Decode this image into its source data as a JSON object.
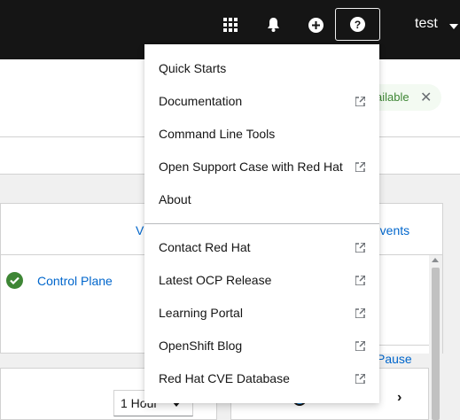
{
  "masthead": {
    "apps_icon": "grid-icon",
    "notifications_icon": "bell-icon",
    "add_icon": "plus-circle-icon",
    "help_icon": "question-circle-icon",
    "user_name": "test"
  },
  "background": {
    "badge_text": "ailable",
    "card_links": [
      "V",
      "v events"
    ],
    "status_label": "Control Plane",
    "pause_label": "Pause",
    "time_select": "1 Hour"
  },
  "help_menu": {
    "group1": [
      {
        "label": "Quick Starts",
        "external": false
      },
      {
        "label": "Documentation",
        "external": true
      },
      {
        "label": "Command Line Tools",
        "external": false
      },
      {
        "label": "Open Support Case with Red Hat",
        "external": true
      },
      {
        "label": "About",
        "external": false
      }
    ],
    "group2": [
      {
        "label": "Contact Red Hat",
        "external": true
      },
      {
        "label": "Latest OCP Release",
        "external": true
      },
      {
        "label": "Learning Portal",
        "external": true
      },
      {
        "label": "OpenShift Blog",
        "external": true
      },
      {
        "label": "Red Hat CVE Database",
        "external": true
      }
    ]
  },
  "colors": {
    "masthead": "#151515",
    "link": "#0066cc",
    "success": "#3e8635"
  }
}
